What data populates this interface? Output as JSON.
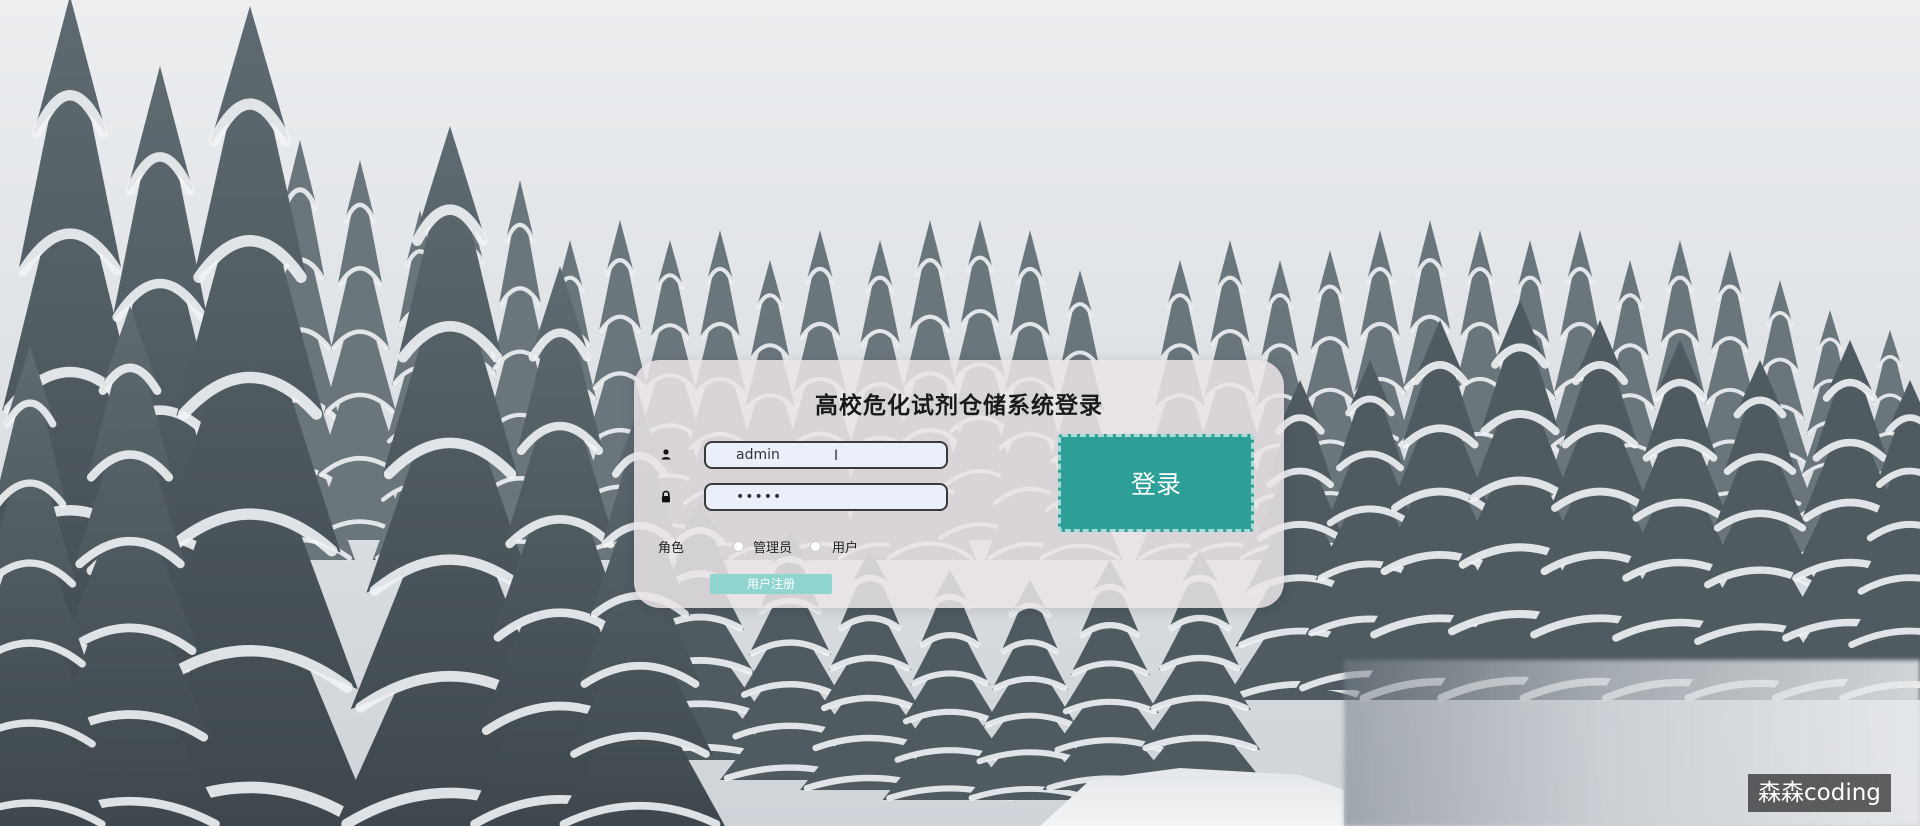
{
  "login": {
    "title": "高校危化试剂仓储系统登录",
    "username_value": "admin",
    "password_value": "•••••",
    "role_label": "角色",
    "role_options": [
      "管理员",
      "用户"
    ],
    "register_label": "用户注册",
    "login_label": "登录"
  },
  "icons": {
    "username": "user-icon",
    "password": "lock-icon"
  },
  "colors": {
    "login_button": "#2d9f97",
    "register_button": "#8fd4cf",
    "card_background": "#eae4e6",
    "input_background": "#ebeefb"
  },
  "watermark": {
    "text": "森森coding"
  }
}
